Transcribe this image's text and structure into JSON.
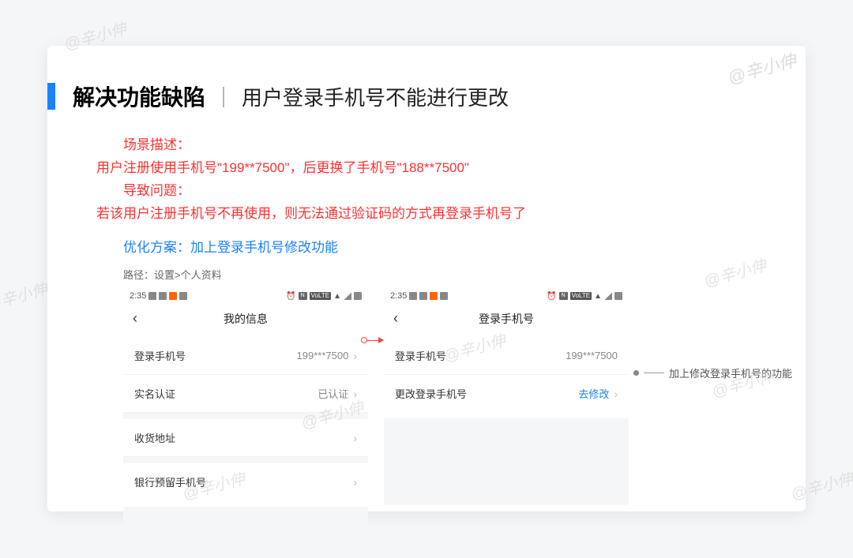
{
  "watermark": "@辛小伸",
  "title": {
    "main": "解决功能缺陷",
    "separator": "｜",
    "sub": "用户登录手机号不能进行更改"
  },
  "description": {
    "scene_label": "场景描述：",
    "scene_body": "用户注册使用手机号\"199**7500\"，后更换了手机号\"188**7500\"",
    "problem_label": "导致问题：",
    "problem_body": "若该用户注册手机号不再使用，则无法通过验证码的方式再登录手机号了"
  },
  "solution": "优化方案：加上登录手机号修改功能",
  "path_label": "路径：设置>个人资料",
  "statusbar": {
    "time": "2:35",
    "volte": "VoLTE"
  },
  "mock1": {
    "nav_title": "我的信息",
    "rows": {
      "login_phone_label": "登录手机号",
      "login_phone_value": "199***7500",
      "realname_label": "实名认证",
      "realname_value": "已认证",
      "address_label": "收货地址",
      "bank_phone_label": "银行预留手机号"
    }
  },
  "mock2": {
    "nav_title": "登录手机号",
    "rows": {
      "login_phone_label": "登录手机号",
      "login_phone_value": "199***7500",
      "change_label": "更改登录手机号",
      "change_value": "去修改"
    }
  },
  "annotation": "加上修改登录手机号的功能"
}
